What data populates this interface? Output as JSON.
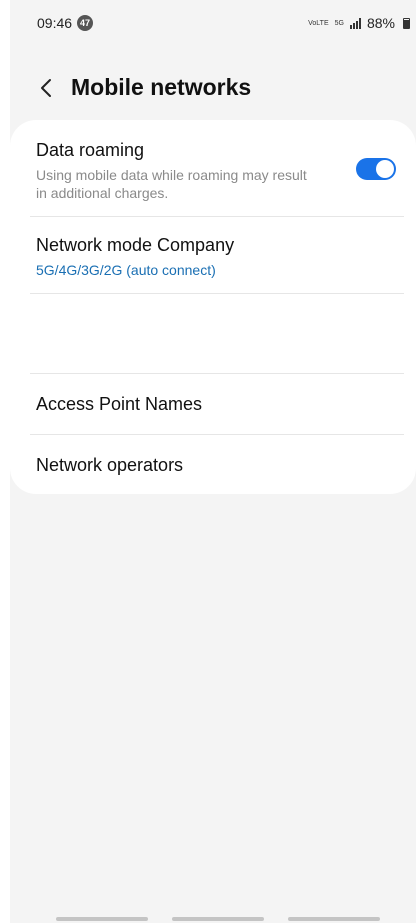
{
  "status_bar": {
    "time": "09:46",
    "notification_count": "47",
    "volte_label": "VoLTE",
    "network_type": "5G",
    "battery": "88%"
  },
  "header": {
    "title": "Mobile networks",
    "back_icon": "chevron-left-icon"
  },
  "settings": {
    "data_roaming": {
      "title": "Data roaming",
      "description": "Using mobile data while roaming may result in additional charges.",
      "enabled": true
    },
    "network_mode": {
      "title": "Network mode Company",
      "value": "5G/4G/3G/2G (auto connect)"
    },
    "access_point_names": {
      "title": "Access Point Names"
    },
    "network_operators": {
      "title": "Network operators"
    }
  },
  "colors": {
    "accent": "#1a73e8",
    "link_text": "#1a6fb3",
    "background": "#f4f4f4",
    "card": "#ffffff"
  }
}
